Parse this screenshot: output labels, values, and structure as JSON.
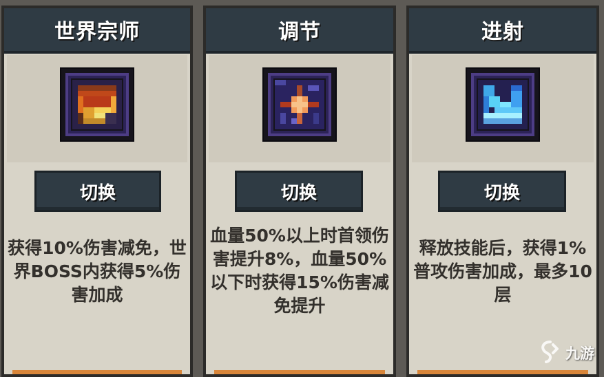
{
  "cards": [
    {
      "title": "世界宗师",
      "icon": "world-master-shield-icon",
      "button_label": "切换",
      "description": "获得10%伤害减免，世界BOSS内获得5%伤害加成"
    },
    {
      "title": "调节",
      "icon": "adjust-cross-icon",
      "button_label": "切换",
      "description": "血量50%以上时首领伤害提升8%，血量50%以下时获得15%伤害减免提升"
    },
    {
      "title": "进射",
      "icon": "shoot-arrow-icon",
      "button_label": "切换",
      "description": "释放技能后，获得1%普攻伤害加成，最多10层"
    }
  ],
  "watermark": {
    "text": "九游",
    "icon": "jiuyou-logo-icon"
  },
  "colors": {
    "header_bg": "#2f3b44",
    "card_bg": "#d8d4c8",
    "accent_bar": "#d8863a",
    "frame_purple": "#4d3d85"
  }
}
